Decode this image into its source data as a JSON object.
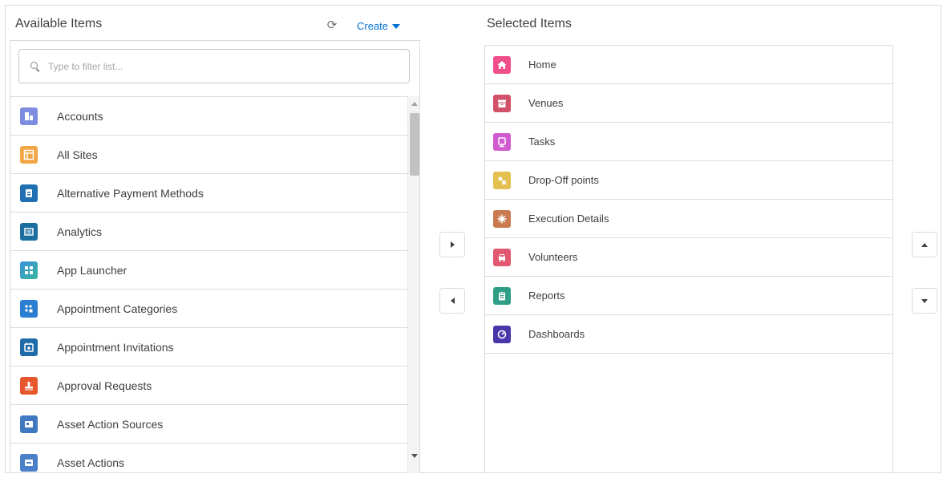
{
  "available": {
    "title": "Available Items",
    "create_label": "Create",
    "search_placeholder": "Type to filter list...",
    "items": [
      {
        "label": "Accounts",
        "icon": "accounts-icon",
        "color": "#7f8de1"
      },
      {
        "label": "All Sites",
        "icon": "all-sites-icon",
        "color": "#f2a744"
      },
      {
        "label": "Alternative Payment Methods",
        "icon": "payment-icon",
        "color": "#1f6fb2"
      },
      {
        "label": "Analytics",
        "icon": "analytics-icon",
        "color": "#1a6fa0"
      },
      {
        "label": "App Launcher",
        "icon": "app-launcher-icon",
        "color": "#3c8fdd"
      },
      {
        "label": "Appointment Categories",
        "icon": "appointment-categories-icon",
        "color": "#2a7fd0"
      },
      {
        "label": "Appointment Invitations",
        "icon": "appointment-invitations-icon",
        "color": "#1f6aa8"
      },
      {
        "label": "Approval Requests",
        "icon": "approval-icon",
        "color": "#e6572c"
      },
      {
        "label": "Asset Action Sources",
        "icon": "asset-action-sources-icon",
        "color": "#3f79c2"
      },
      {
        "label": "Asset Actions",
        "icon": "asset-actions-icon",
        "color": "#4a80c9"
      }
    ]
  },
  "selected": {
    "title": "Selected Items",
    "items": [
      {
        "label": "Home",
        "icon": "home-icon",
        "color": "#ef4e8a"
      },
      {
        "label": "Venues",
        "icon": "venues-icon",
        "color": "#d1506a"
      },
      {
        "label": "Tasks",
        "icon": "tasks-icon",
        "color": "#d15ad0"
      },
      {
        "label": "Drop-Off points",
        "icon": "drop-off-icon",
        "color": "#e3c04f"
      },
      {
        "label": "Execution Details",
        "icon": "execution-details-icon",
        "color": "#c97a4e"
      },
      {
        "label": "Volunteers",
        "icon": "volunteers-icon",
        "color": "#e25870"
      },
      {
        "label": "Reports",
        "icon": "reports-icon",
        "color": "#2e9e86"
      },
      {
        "label": "Dashboards",
        "icon": "dashboards-icon",
        "color": "#4a36a8"
      }
    ]
  }
}
